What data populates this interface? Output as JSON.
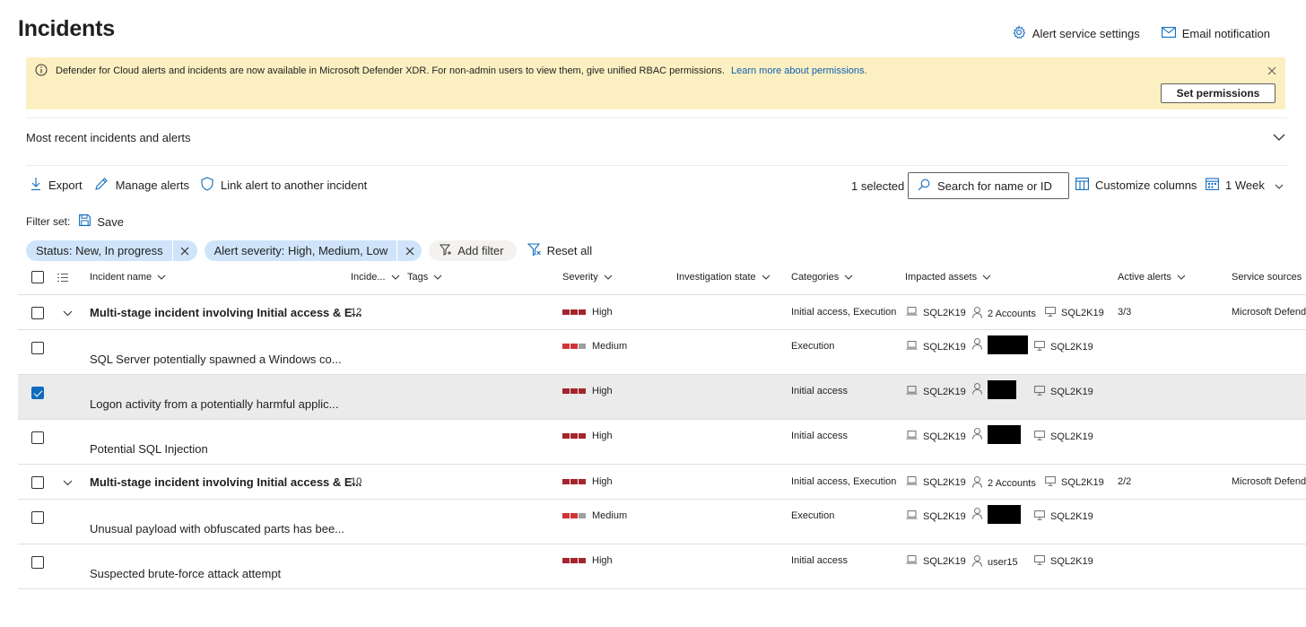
{
  "header": {
    "title": "Incidents",
    "alert_service_settings": "Alert service settings",
    "email_notification": "Email notification"
  },
  "banner": {
    "text": "Defender for Cloud alerts and incidents are now available in Microsoft Defender XDR. For non-admin users to view them, give unified RBAC permissions.",
    "link": "Learn more about permissions.",
    "button": "Set permissions"
  },
  "recent": {
    "label": "Most recent incidents and alerts"
  },
  "toolbar": {
    "export": "Export",
    "manage_alerts": "Manage alerts",
    "link_alert": "Link alert to another incident",
    "selected": "1 selected",
    "search_placeholder": "Search for name or ID",
    "customize_columns": "Customize columns",
    "time_range": "1 Week"
  },
  "filters": {
    "filter_set_label": "Filter set:",
    "save": "Save",
    "chips": [
      "Status: New, In progress",
      "Alert severity: High, Medium, Low"
    ],
    "add_filter": "Add filter",
    "reset_all": "Reset all"
  },
  "columns": {
    "incident_name": "Incident name",
    "incident_id": "Incide...",
    "tags": "Tags",
    "severity": "Severity",
    "investigation_state": "Investigation state",
    "categories": "Categories",
    "impacted_assets": "Impacted assets",
    "active_alerts": "Active alerts",
    "service_sources": "Service sources"
  },
  "rows": [
    {
      "type": "incident",
      "name": "Multi-stage incident involving Initial access & E...",
      "id": "12",
      "severity": "High",
      "severity_level": 3,
      "category": "Initial access, Execution",
      "device": "SQL2K19",
      "user": "2 Accounts",
      "machine": "SQL2K19",
      "active_alerts": "3/3",
      "service_sources": "Microsoft Defend",
      "checked": false
    },
    {
      "type": "alert",
      "name": "SQL Server potentially spawned a Windows co...",
      "severity": "Medium",
      "severity_level": 2,
      "category": "Execution",
      "device": "SQL2K19",
      "user": "",
      "machine": "SQL2K19",
      "checked": false
    },
    {
      "type": "alert",
      "name": "Logon activity from a potentially harmful applic...",
      "severity": "High",
      "severity_level": 3,
      "category": "Initial access",
      "device": "SQL2K19",
      "user": "",
      "machine": "SQL2K19",
      "checked": true
    },
    {
      "type": "alert",
      "name": "Potential SQL Injection",
      "severity": "High",
      "severity_level": 3,
      "category": "Initial access",
      "device": "SQL2K19",
      "user": "",
      "machine": "SQL2K19",
      "checked": false
    },
    {
      "type": "incident",
      "name": "Multi-stage incident involving Initial access & E...",
      "id": "10",
      "severity": "High",
      "severity_level": 3,
      "category": "Initial access, Execution",
      "device": "SQL2K19",
      "user": "2 Accounts",
      "machine": "SQL2K19",
      "active_alerts": "2/2",
      "service_sources": "Microsoft Defend",
      "checked": false
    },
    {
      "type": "alert",
      "name": "Unusual payload with obfuscated parts has bee...",
      "severity": "Medium",
      "severity_level": 2,
      "category": "Execution",
      "device": "SQL2K19",
      "user": "",
      "machine": "SQL2K19",
      "checked": false
    },
    {
      "type": "alert",
      "name": "Suspected brute-force attack attempt",
      "severity": "High",
      "severity_level": 3,
      "category": "Initial access",
      "device": "SQL2K19",
      "user": "user15",
      "machine": "SQL2K19",
      "checked": false
    }
  ]
}
